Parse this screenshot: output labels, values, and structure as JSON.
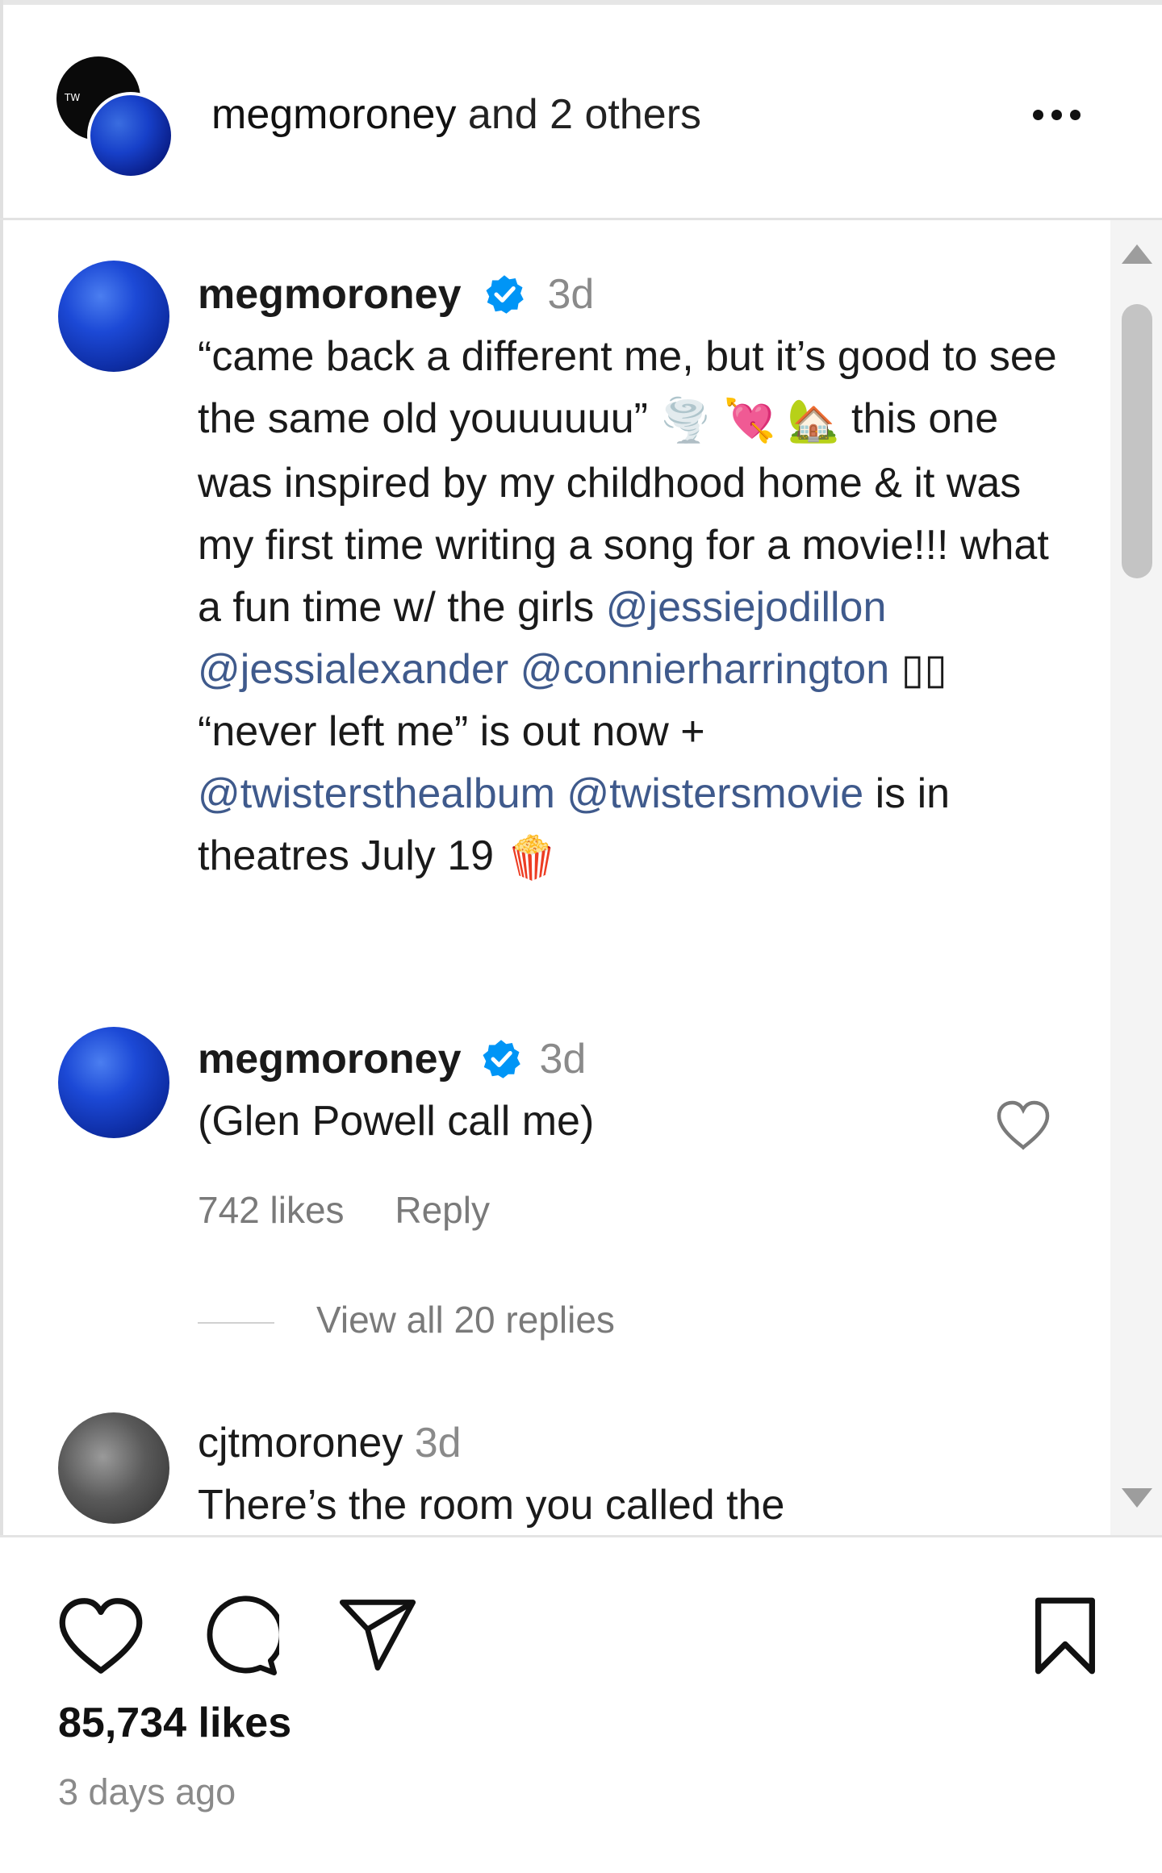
{
  "header": {
    "username": "megmoroney",
    "others_text": "and 2 others",
    "back_avatar_text": "TW",
    "more_icon": "more-horizontal-icon"
  },
  "caption": {
    "username": "megmoroney",
    "time": "3d",
    "text_1": "“came back a different me, but it’s good to see the same old youuuuuu”",
    "text_2": "this one was inspired by my childhood home & it was my first time writing a song for a movie!!! what a fun time w/ the girls",
    "mention_1": "@jessiejodillon",
    "mention_2": "@jessialexander",
    "mention_3": "@connierharrington",
    "text_3": "▯▯ “never left me” is out now +",
    "mention_4": "@twistersthealbum",
    "mention_5": "@twistersmovie",
    "text_4": "is in theatres July 19",
    "emoji_1": "🌪️",
    "emoji_2": "💘",
    "emoji_3": "🏡",
    "emoji_4": "🍿"
  },
  "comments": [
    {
      "username": "megmoroney",
      "time": "3d",
      "text": "(Glen Powell call me)",
      "likes": "742 likes",
      "reply": "Reply",
      "view_replies": "View all 20 replies"
    },
    {
      "username": "cjtmoroney",
      "time": "3d",
      "text": "There’s the room you called the"
    }
  ],
  "footer": {
    "likes": "85,734 likes",
    "posted": "3 days ago"
  },
  "colors": {
    "mention": "#3f5a8c",
    "verified": "#0095f6",
    "muted": "#8a8a8a"
  }
}
